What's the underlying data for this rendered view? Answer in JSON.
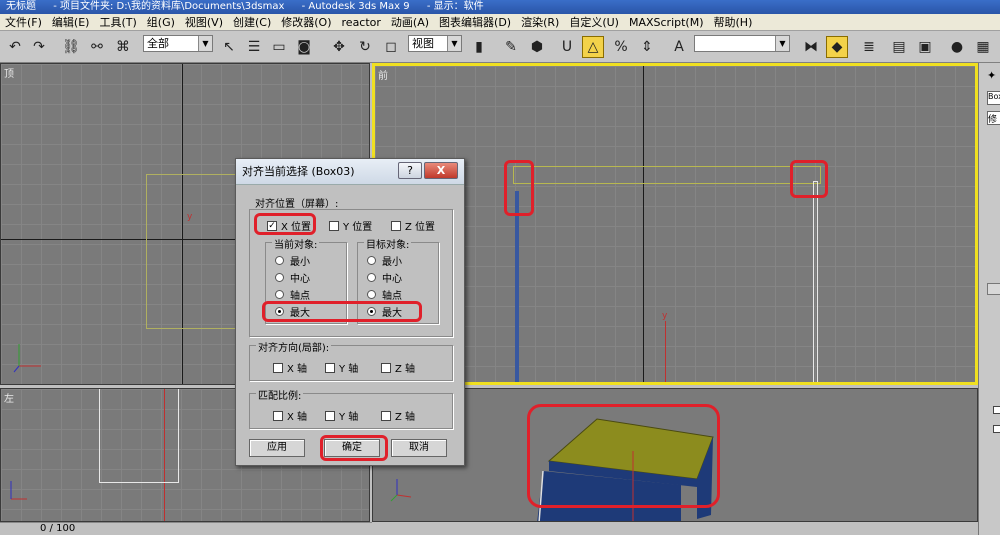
{
  "window": {
    "title_parts": [
      "无标题",
      "- 项目文件夹: D:\\我的资料库\\Documents\\3dsmax",
      "- Autodesk 3ds Max 9",
      "- 显示：软件"
    ]
  },
  "menu": [
    "文件(F)",
    "编辑(E)",
    "工具(T)",
    "组(G)",
    "视图(V)",
    "创建(C)",
    "修改器(O)",
    "reactor",
    "动画(A)",
    "图表编辑器(D)",
    "渲染(R)",
    "自定义(U)",
    "MAXScript(M)",
    "帮助(H)"
  ],
  "toolbar": {
    "selection_filter": "全部",
    "reference_coord": "视图",
    "named_selection": ""
  },
  "viewports": {
    "top_label": "顶",
    "front_label": "前",
    "left_label": "左",
    "persp_label": "",
    "front_axis_y": "y",
    "top_axis_y": "y"
  },
  "command_panel": {
    "object_name": "Box",
    "tab_modify": "修"
  },
  "statusbar": {
    "frame": "0 / 100"
  },
  "dialog": {
    "title": "对齐当前选择 (Box03)",
    "help": "?",
    "close": "X",
    "align_position_label": "对齐位置（屏幕）:",
    "x_pos": "X 位置",
    "y_pos": "Y 位置",
    "z_pos": "Z 位置",
    "current_label": "当前对象:",
    "target_label": "目标对象:",
    "options": [
      "最小",
      "中心",
      "轴点",
      "最大"
    ],
    "orient_label": "对齐方向(局部):",
    "scale_label": "匹配比例:",
    "x_axis": "X 轴",
    "y_axis": "Y 轴",
    "z_axis": "Z 轴",
    "apply": "应用",
    "ok": "确定",
    "cancel": "取消",
    "checked_x": "✓",
    "unchecked": ""
  },
  "colors": {
    "highlight": "#e0202a",
    "active_border": "#f0e020",
    "viewport_bg": "#7a7a7a",
    "box_top": "#8c8c1e",
    "box_side": "#1e3a78"
  }
}
